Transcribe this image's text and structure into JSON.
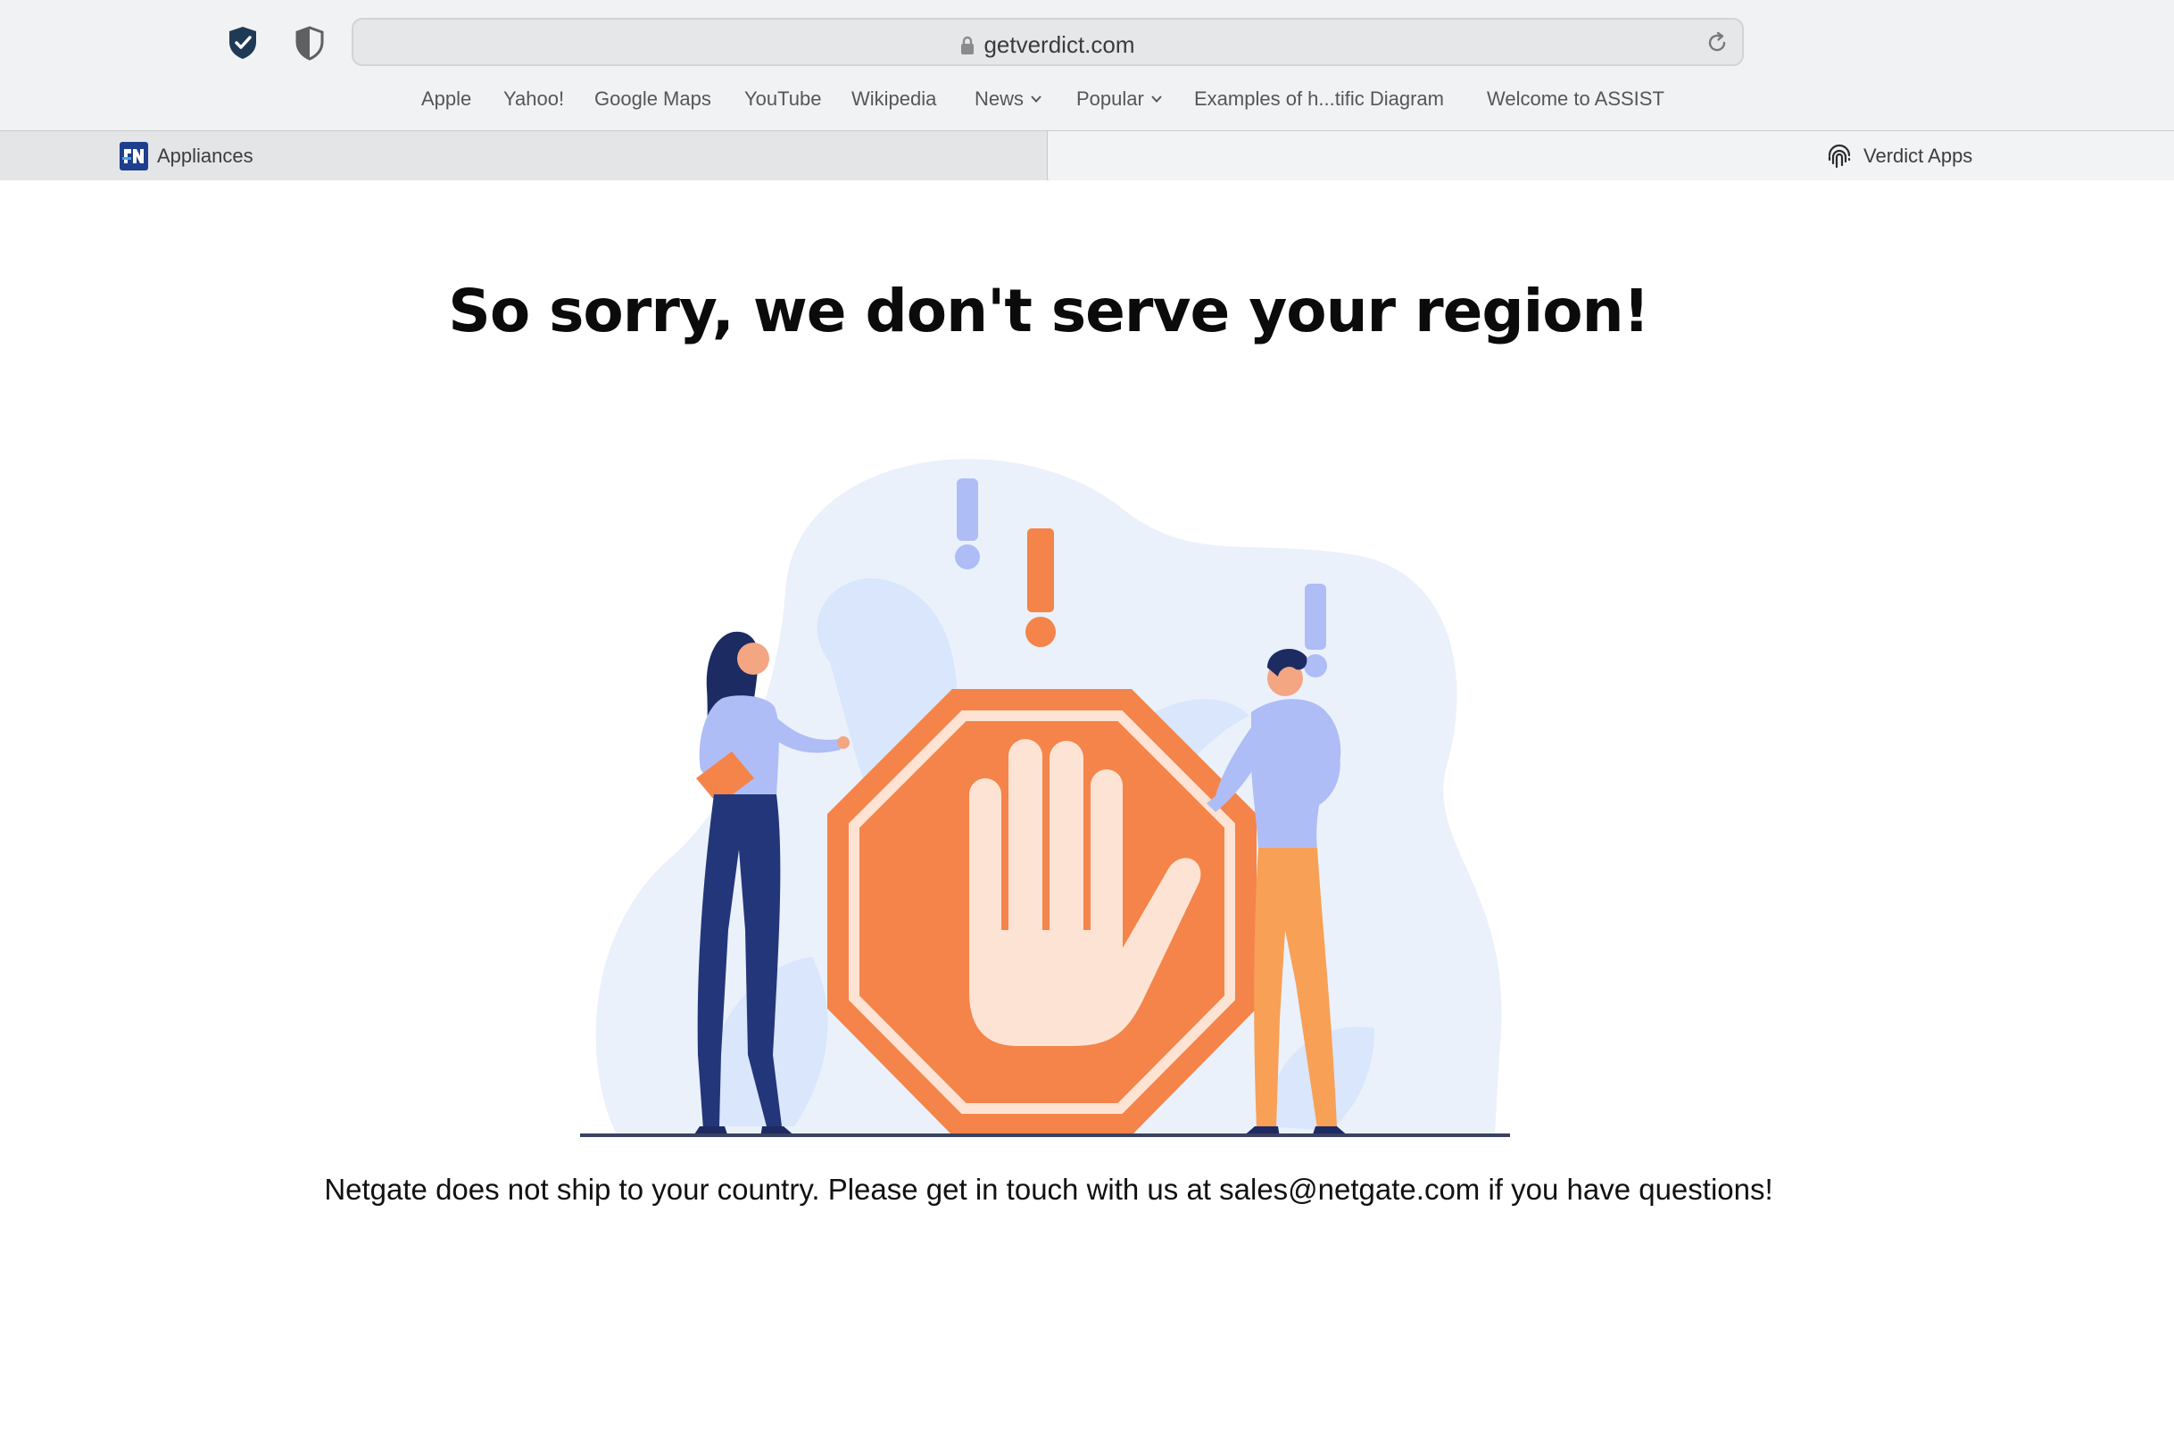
{
  "browser": {
    "url": "getverdict.com",
    "bookmarks": [
      {
        "label": "Apple"
      },
      {
        "label": "Yahoo!"
      },
      {
        "label": "Google Maps"
      },
      {
        "label": "YouTube"
      },
      {
        "label": "Wikipedia"
      },
      {
        "label": "News"
      },
      {
        "label": "Popular"
      },
      {
        "label": "Examples of h...tific Diagram"
      },
      {
        "label": "Welcome to ASSIST"
      }
    ],
    "tabs": [
      {
        "label": "Appliances",
        "active": true,
        "icon": "netgate-icon"
      },
      {
        "label": "Verdict Apps",
        "active": false,
        "icon": "fingerprint-icon"
      }
    ]
  },
  "page": {
    "headline": "So sorry, we don't serve your region!",
    "message": "Netgate does not ship to your country. Please get in touch with us at sales@netgate.com if you have questions!"
  },
  "colors": {
    "accent_orange": "#f4844a",
    "hand": "#fde3d3",
    "blob": "#eaf1fb",
    "leaf": "#d9e6fb",
    "exclamation_blue": "#aebdf6",
    "navy": "#24367a"
  }
}
